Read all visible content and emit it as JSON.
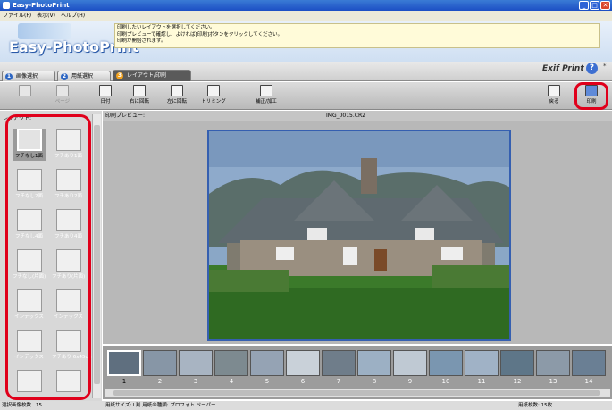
{
  "window": {
    "title": "Easy-PhotoPrint",
    "buttons": [
      "_",
      "□",
      "✕"
    ]
  },
  "menu": [
    "ファイル(F)",
    "表示(V)",
    "ヘルプ(H)"
  ],
  "banner": {
    "logo": "Easy-PhotoPrint",
    "instructions": [
      "印刷したいレイアウトを選択してください。",
      "印刷プレビューで確認し、よければ[印刷]ボタンをクリックしてください。",
      "印刷が開始されます。"
    ]
  },
  "tabs": [
    {
      "num": "1",
      "label": "画像選択"
    },
    {
      "num": "2",
      "label": "用紙選択"
    },
    {
      "num": "3",
      "label": "レイアウト/印刷"
    }
  ],
  "brand": {
    "exif": "Exif Print",
    "help": "?"
  },
  "toolbar": {
    "tools": [
      {
        "label": "",
        "disabled": true
      },
      {
        "label": "ページ",
        "disabled": true
      },
      {
        "label": "日付",
        "disabled": false
      },
      {
        "label": "右に回転",
        "disabled": false
      },
      {
        "label": "左に回転",
        "disabled": false
      },
      {
        "label": "トリミング",
        "disabled": false
      },
      {
        "label": "補正/加工",
        "disabled": false
      }
    ],
    "back_label": "戻る",
    "print_label": "印刷"
  },
  "left_panel": {
    "header": "レイアウト:",
    "layouts": [
      {
        "label": "フチなし1面",
        "selected": true
      },
      {
        "label": "フチあり1面",
        "selected": false
      },
      {
        "label": "フチなし2面",
        "selected": false
      },
      {
        "label": "フチあり2面",
        "selected": false
      },
      {
        "label": "フチなし4面",
        "selected": false
      },
      {
        "label": "フチあり4面",
        "selected": false
      },
      {
        "label": "フチなし(片面)",
        "selected": false
      },
      {
        "label": "フチあり(片面)",
        "selected": false
      },
      {
        "label": "インデックス",
        "selected": false
      },
      {
        "label": "インデックス",
        "selected": false
      },
      {
        "label": "インデックス",
        "selected": false
      },
      {
        "label": "フチあり 6x45cm",
        "selected": false
      },
      {
        "label": "",
        "selected": false
      },
      {
        "label": "",
        "selected": false
      }
    ]
  },
  "preview": {
    "header": "印刷プレビュー:",
    "filename": "IMG_0015.CR2"
  },
  "filmstrip": {
    "numbers": [
      "1",
      "2",
      "3",
      "4",
      "5",
      "6",
      "7",
      "8",
      "9",
      "10",
      "11",
      "12",
      "13",
      "14"
    ],
    "colors": [
      "#5f6f7f",
      "#8796a6",
      "#a8b4c2",
      "#7d8a90",
      "#95a3b4",
      "#c9d1d9",
      "#6f7d8a",
      "#9cb0c4",
      "#bfc9d3",
      "#7a96b0",
      "#a0b2c6",
      "#5e7688",
      "#8c9aa8",
      "#6a7f94"
    ]
  },
  "status": {
    "count_label": "選択画像枚数",
    "count": "15",
    "paper_info": "用紙サイズ: L判 用紙の種類: プロフォト ペーパー",
    "total_label": "用紙枚数: 15枚"
  }
}
